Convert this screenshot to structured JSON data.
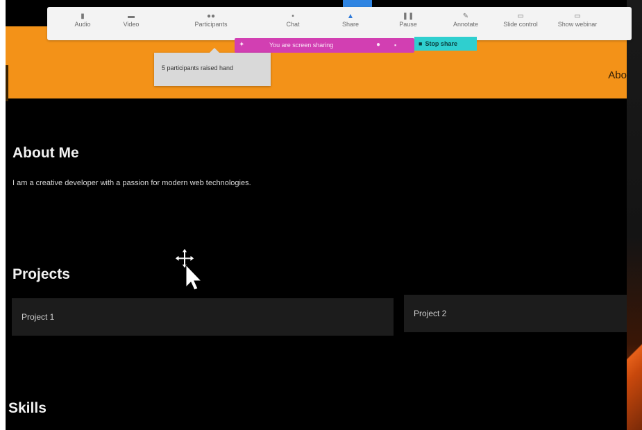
{
  "toolbar": {
    "items": [
      {
        "label": "Audio",
        "icon": "microphone-icon"
      },
      {
        "label": "Video",
        "icon": "video-camera-icon"
      },
      {
        "label": "Participants",
        "icon": "participants-icon"
      },
      {
        "label": "Chat",
        "icon": "chat-icon"
      },
      {
        "label": "Share",
        "icon": "share-screen-icon"
      },
      {
        "label": "Pause",
        "icon": "pause-icon"
      },
      {
        "label": "Annotate",
        "icon": "annotate-icon"
      },
      {
        "label": "Slide control",
        "icon": "slide-control-icon"
      },
      {
        "label": "Show webinar",
        "icon": "show-webinar-icon"
      }
    ],
    "share_bar_text": "You are screen sharing",
    "stop_share_label": "Stop share",
    "raise_hand_tooltip": "5 participants raised hand"
  },
  "page": {
    "nav_about": "Abo",
    "about_heading": "About Me",
    "about_text": "I am a creative developer with a passion for modern web technologies.",
    "projects_heading": "Projects",
    "projects": [
      "Project 1",
      "Project 2"
    ],
    "skills_heading": "Skills"
  },
  "colors": {
    "header_orange": "#f39218",
    "page_background": "#000000",
    "share_bar_magenta": "#d23fb2",
    "stop_share_teal": "#2fcfcf"
  }
}
